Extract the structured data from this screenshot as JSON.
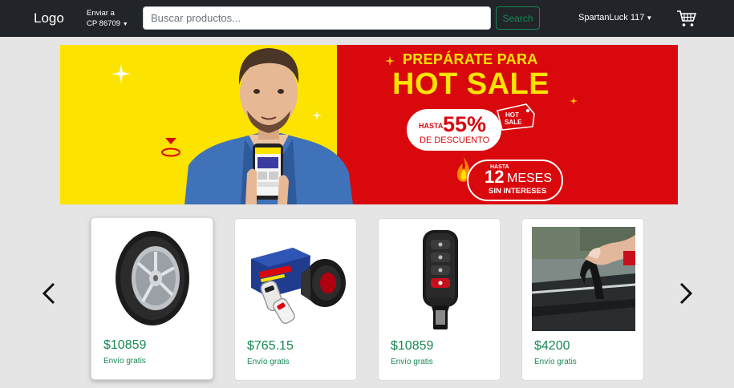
{
  "navbar": {
    "logo": "Logo",
    "ship_to_line1": "Enviar a",
    "ship_to_line2": "CP 86709",
    "search_placeholder": "Buscar productos...",
    "search_button": "Search",
    "username": "SpartanLuck 117",
    "cart_icon": "cart-icon"
  },
  "banner": {
    "headline_small": "PREPÁRATE PARA",
    "headline_big": "HOT SALE",
    "discount_prefix": "HASTA",
    "discount_value": "55%",
    "discount_label": "DE DESCUENTO",
    "tag_text_1": "HOT",
    "tag_text_2": "SALE",
    "months_prefix": "HASTA",
    "months_value": "12",
    "months_label": "MESES",
    "months_suffix": "SIN INTERESES"
  },
  "carousel": {
    "products": [
      {
        "name": "tire",
        "price": "$10859",
        "shipping": "Envío gratis"
      },
      {
        "name": "car-alarm",
        "price": "$765.15",
        "shipping": "Envío gratis"
      },
      {
        "name": "key-remote",
        "price": "$10859",
        "shipping": "Envío gratis"
      },
      {
        "name": "window-seal",
        "price": "$4200",
        "shipping": "Envío gratis"
      }
    ]
  },
  "colors": {
    "navbar_bg": "#212529",
    "accent_green": "#198754",
    "banner_yellow": "#fde300",
    "banner_red": "#d9080d",
    "page_bg": "#e5e5e5"
  }
}
